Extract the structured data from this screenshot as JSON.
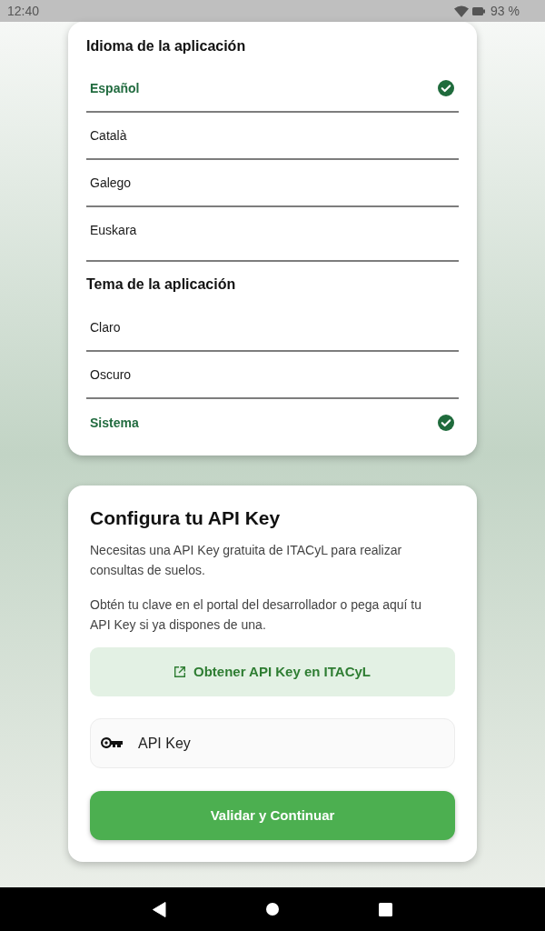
{
  "status_bar": {
    "time": "12:40",
    "battery": "93 %"
  },
  "language_section": {
    "title": "Idioma de la aplicación",
    "options": [
      {
        "label": "Español",
        "selected": true
      },
      {
        "label": "Català",
        "selected": false
      },
      {
        "label": "Galego",
        "selected": false
      },
      {
        "label": "Euskara",
        "selected": false
      }
    ]
  },
  "theme_section": {
    "title": "Tema de la aplicación",
    "options": [
      {
        "label": "Claro",
        "selected": false
      },
      {
        "label": "Oscuro",
        "selected": false
      },
      {
        "label": "Sistema",
        "selected": true
      }
    ]
  },
  "api_key_card": {
    "title": "Configura tu API Key",
    "paragraphs": [
      "Necesitas una API Key gratuita de ITACyL para realizar consultas de suelos.",
      "Obtén tu clave en el portal del desarrollador o pega aquí tu API Key si ya dispones de una."
    ],
    "link_button": {
      "label": "Obtener API Key en ITACyL"
    },
    "api_key_field": {
      "placeholder": "API Key"
    },
    "submit_button": {
      "label": "Validar y Continuar"
    }
  }
}
